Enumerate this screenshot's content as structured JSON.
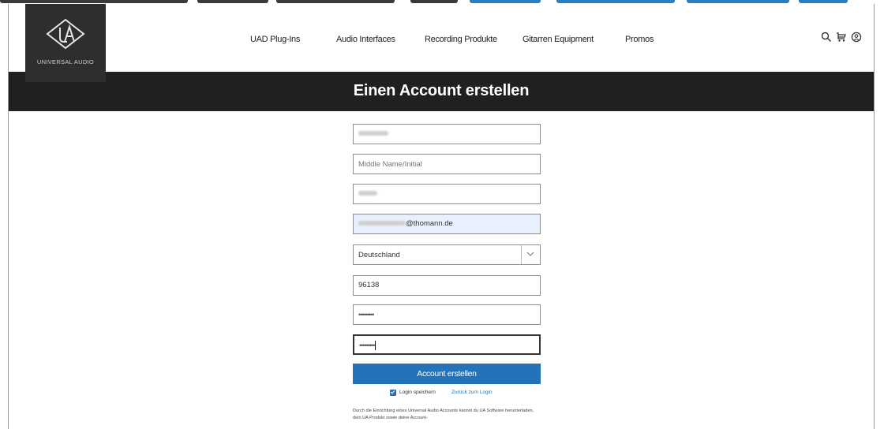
{
  "brand": {
    "wordmark": "UNIVERSAL AUDIO"
  },
  "nav": {
    "items": [
      "UAD Plug-Ins",
      "Audio Interfaces",
      "Recording Produkte",
      "Gitarren Equipment",
      "Promos"
    ]
  },
  "header_icons": [
    "search-icon",
    "cart-icon",
    "account-icon"
  ],
  "page": {
    "title": "Einen Account erstellen"
  },
  "form": {
    "middle_name_placeholder": "Middle Name/Initial",
    "email_visible_suffix": "@thomann.de",
    "country": "Deutschland",
    "postal_code": "96138",
    "password_mask": "•••••••••",
    "confirm_mask": "•••••••••",
    "submit_label": "Account erstellen",
    "remember_label": "Login speichern",
    "back_link": "Zurück zum Login",
    "remember_checked": true
  },
  "legal": {
    "text": "Durch die Einrichtung eines Universal Audio Accounts kannst du UA Software herunterladen, dein UA Produkt sowie deine Account-"
  },
  "colors": {
    "accent": "#2473b8",
    "banner": "#202020",
    "logo_bg": "#2e2e2e"
  }
}
